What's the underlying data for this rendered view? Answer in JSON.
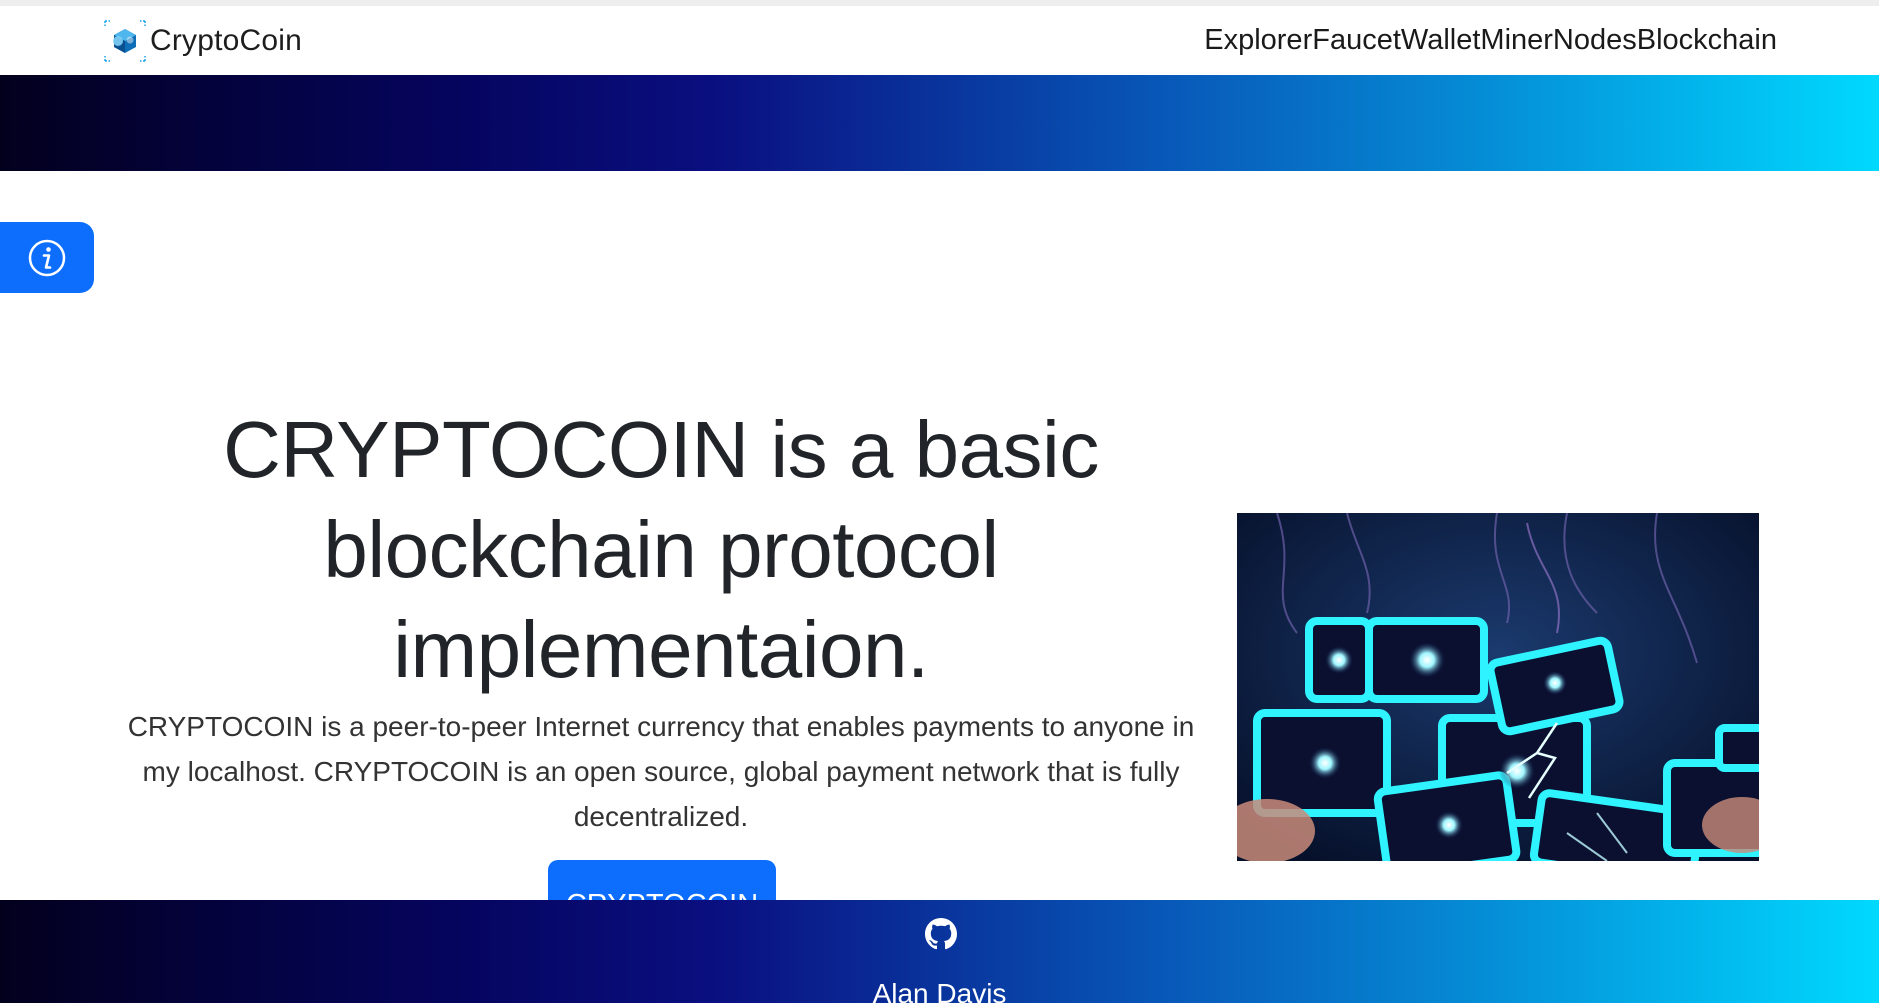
{
  "brand": {
    "name": "CryptoCoin",
    "logo_icon": "cube-logo-icon"
  },
  "nav": {
    "items": [
      {
        "label": "Explorer"
      },
      {
        "label": "Faucet"
      },
      {
        "label": "Wallet"
      },
      {
        "label": "Miner"
      },
      {
        "label": "Nodes"
      },
      {
        "label": "Blockchain"
      }
    ]
  },
  "info_tab": {
    "icon": "info-circle-icon"
  },
  "hero": {
    "title": "CRYPTOCOIN is a basic blockchain protocol implementaion.",
    "lead": "CRYPTOCOIN is a peer-to-peer Internet currency that enables payments to anyone in my localhost. CRYPTOCOIN is an open source, global payment network that is fully decentralized.",
    "button_label": "CRYPTOCOIN",
    "image_icon": "glowing-blockchain-cubes-image"
  },
  "footer": {
    "icon": "github-icon",
    "author": "Alan Davis"
  },
  "colors": {
    "primary": "#0d6efd",
    "gradient_start": "#03001e",
    "gradient_mid": "#0a0f80",
    "gradient_end": "#00d9ff"
  }
}
